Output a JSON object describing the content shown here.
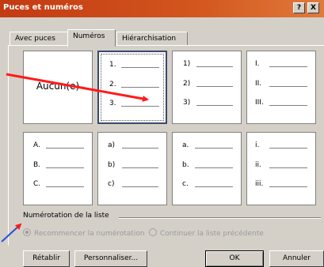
{
  "window": {
    "title": "Puces et numéros",
    "help_label": "?",
    "close_label": "X"
  },
  "tabs": [
    {
      "label": "Avec puces"
    },
    {
      "label": "Numéros"
    },
    {
      "label": "Hiérarchisation"
    }
  ],
  "gallery": {
    "none_label": "Aucun(e)",
    "cells": [
      {
        "markers": [
          "1.",
          "2.",
          "3."
        ]
      },
      {
        "markers": [
          "1)",
          "2)",
          "3)"
        ]
      },
      {
        "markers": [
          "I.",
          "II.",
          "III."
        ]
      },
      {
        "markers": [
          "A.",
          "B.",
          "C."
        ]
      },
      {
        "markers": [
          "a)",
          "b)",
          "c)"
        ]
      },
      {
        "markers": [
          "a.",
          "b.",
          "c."
        ]
      },
      {
        "markers": [
          "i.",
          "ii.",
          "iii."
        ]
      }
    ]
  },
  "numbering": {
    "group_label": "Numérotation de la liste",
    "restart_label": "Recommencer la numérotation",
    "continue_label": "Continuer la liste précédente"
  },
  "buttons": {
    "reset": "Rétablir",
    "customize": "Personnaliser...",
    "ok": "OK",
    "cancel": "Annuler"
  },
  "colors": {
    "titlebar": "#c23a12",
    "arrow": "#ff1a1a",
    "dialog_bg": "#d4d0c8"
  }
}
